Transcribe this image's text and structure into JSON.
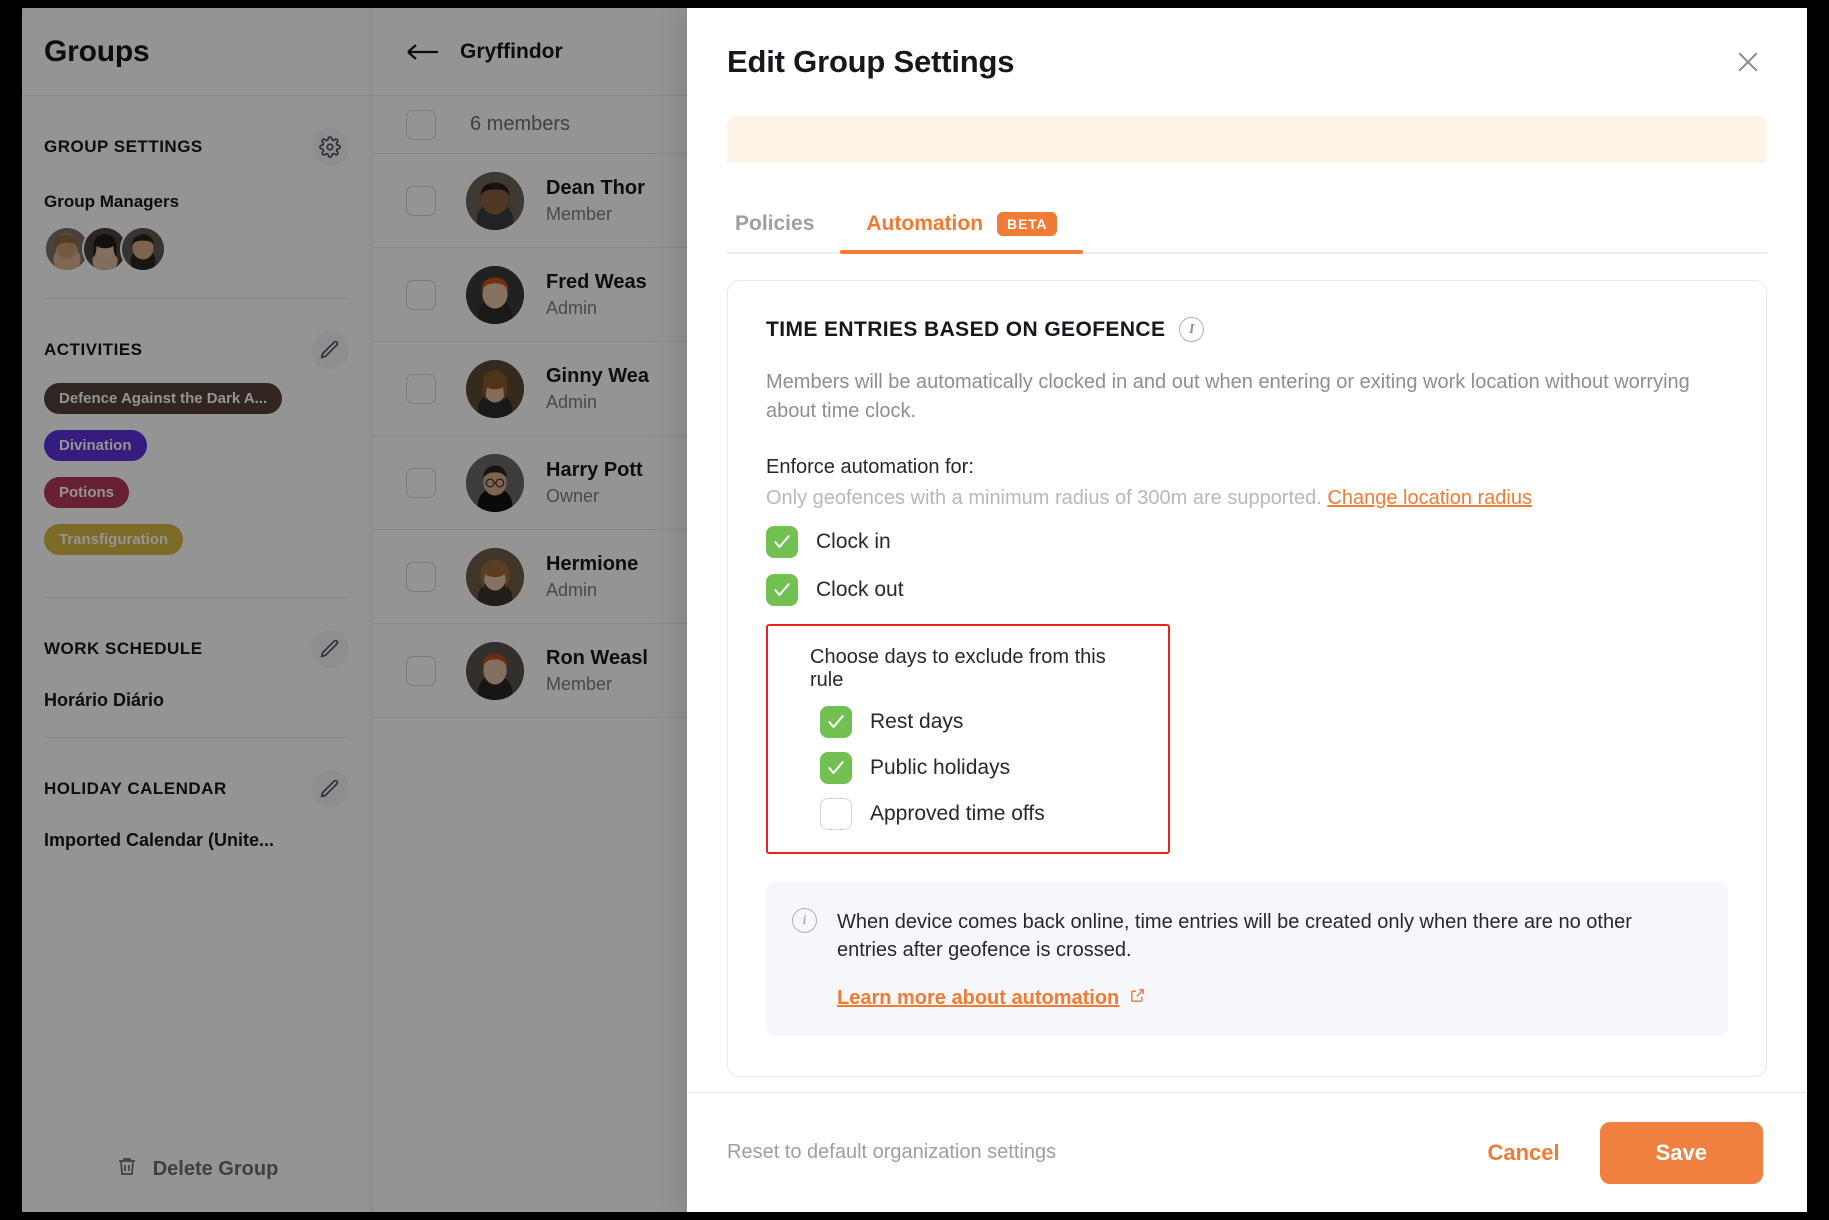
{
  "background_app": {
    "sidebar": {
      "title": "Groups",
      "group_settings": {
        "label": "GROUP SETTINGS",
        "icon": "gear-icon"
      },
      "group_managers": {
        "label": "Group Managers",
        "avatar_count": 3
      },
      "activities": {
        "label": "ACTIVITIES",
        "icon": "pencil-icon",
        "chips": [
          {
            "label": "Defence Against the Dark A...",
            "color": "#53413a"
          },
          {
            "label": "Divination",
            "color": "#5b33d9"
          },
          {
            "label": "Potions",
            "color": "#b13a59"
          },
          {
            "label": "Transfiguration",
            "color": "#d4b843"
          }
        ]
      },
      "work_schedule": {
        "label": "WORK SCHEDULE",
        "icon": "pencil-icon",
        "value": "Horário Diário"
      },
      "holiday_calendar": {
        "label": "HOLIDAY CALENDAR",
        "icon": "pencil-icon",
        "value": "Imported Calendar (Unite..."
      },
      "delete_group": {
        "label": "Delete Group",
        "icon": "trash-icon"
      }
    },
    "members_panel": {
      "group_name": "Gryffindor",
      "back_icon": "arrow-left-icon",
      "count_label": "6 members",
      "rows": [
        {
          "name": "Dean Thor",
          "role": "Member",
          "hair": "#2a1d14",
          "skin": "#8a5f3f",
          "bg": "#6b6258"
        },
        {
          "name": "Fred Weas",
          "role": "Admin",
          "hair": "#c4521f",
          "skin": "#e8c3a6",
          "bg": "#3c3a39"
        },
        {
          "name": "Ginny Wea",
          "role": "Admin",
          "hair": "#8a5a24",
          "skin": "#e3bb9c",
          "bg": "#5c4a33"
        },
        {
          "name": "Harry Pott",
          "role": "Owner",
          "hair": "#2d2218",
          "skin": "#d8ae8e",
          "bg": "#6d6a68"
        },
        {
          "name": "Hermione",
          "role": "Admin",
          "hair": "#9c6c36",
          "skin": "#e6c4a8",
          "bg": "#6e5c47"
        },
        {
          "name": "Ron Weasl",
          "role": "Member",
          "hair": "#b5511c",
          "skin": "#e5bfa2",
          "bg": "#57524c"
        }
      ]
    }
  },
  "modal": {
    "title": "Edit Group Settings",
    "close_icon": "close-icon",
    "banner_peek_text": "",
    "tabs": [
      {
        "label": "Policies",
        "active": false,
        "badge": ""
      },
      {
        "label": "Automation",
        "active": true,
        "badge": "BETA"
      }
    ],
    "card": {
      "title": "TIME ENTRIES BASED ON GEOFENCE",
      "info_icon": "info-icon",
      "description": "Members will be automatically clocked in and out when entering or exiting work location without worrying about time clock.",
      "enforce_label": "Enforce automation for:",
      "radius_note": "Only geofences with a minimum radius of 300m are supported.",
      "radius_link": "Change location radius",
      "options": [
        {
          "label": "Clock in",
          "checked": true
        },
        {
          "label": "Clock out",
          "checked": true
        }
      ],
      "exclude": {
        "title": "Choose days to exclude from this rule",
        "highlight_color": "#ee2020",
        "options": [
          {
            "label": "Rest days",
            "checked": true
          },
          {
            "label": "Public holidays",
            "checked": true
          },
          {
            "label": "Approved time offs",
            "checked": false
          }
        ]
      },
      "note": {
        "icon": "info-icon",
        "text": "When device comes back online, time entries will be created only when there are no other entries after geofence is crossed.",
        "link": "Learn more about automation",
        "link_icon": "external-link-icon"
      }
    },
    "footer": {
      "reset_label": "Reset to default organization settings",
      "cancel_label": "Cancel",
      "save_label": "Save"
    }
  },
  "colors": {
    "accent": "#ef7b34",
    "accent_button": "#ef8040",
    "checkbox_green": "#72bf52",
    "highlight_red": "#ee2020",
    "banner_bg": "#fdf3e7",
    "note_bg": "#f5f7fa"
  }
}
